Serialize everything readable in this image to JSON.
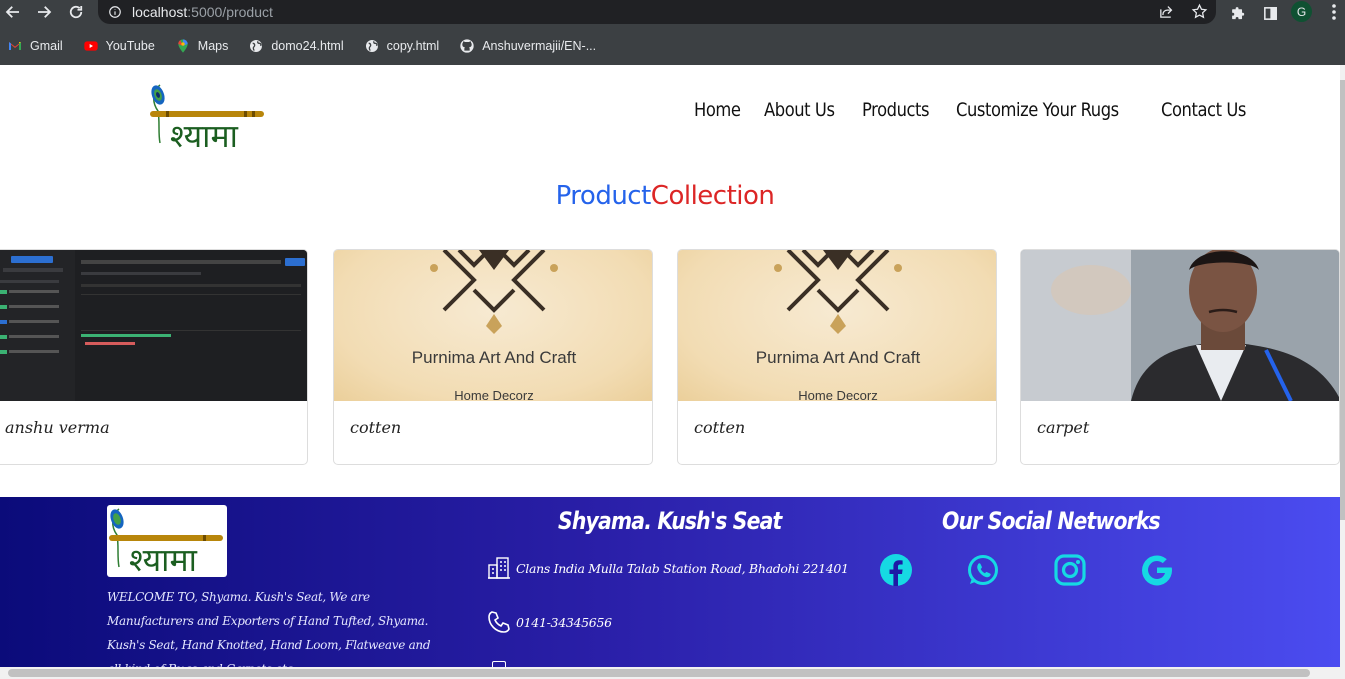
{
  "browser": {
    "url_host": "localhost",
    "url_path": ":5000/product",
    "profile_initial": "G",
    "bookmarks": [
      {
        "label": "Gmail",
        "icon": "gmail-icon"
      },
      {
        "label": "YouTube",
        "icon": "youtube-icon"
      },
      {
        "label": "Maps",
        "icon": "maps-icon"
      },
      {
        "label": "domo24.html",
        "icon": "globe-icon"
      },
      {
        "label": "copy.html",
        "icon": "globe-icon"
      },
      {
        "label": "Anshuvermajii/EN-...",
        "icon": "github-icon"
      }
    ]
  },
  "site": {
    "logo_text": "श्यामा",
    "nav": [
      "Home",
      "About Us",
      "Products",
      "Customize Your Rugs",
      "Contact Us"
    ],
    "heading_part1": "Product",
    "heading_part2": "Collection",
    "heading_colors": {
      "part1": "#2563eb",
      "part2": "#dc2626"
    }
  },
  "products": [
    {
      "name": "anshu verma",
      "image": "screenshot"
    },
    {
      "name": "cotten",
      "image": "purnima",
      "image_title": "Purnima Art And Craft",
      "image_subtitle": "Home Decorz"
    },
    {
      "name": "cotten",
      "image": "purnima",
      "image_title": "Purnima Art And Craft",
      "image_subtitle": "Home Decorz"
    },
    {
      "name": "carpet",
      "image": "photo"
    }
  ],
  "footer": {
    "logo_text": "श्यामा",
    "description": "WELCOME TO, Shyama. Kush's Seat, We are Manufacturers and Exporters of Hand Tufted, Shyama. Kush's Seat, Hand Knotted, Hand Loom, Flatweave and all kind of Rugs and Carpets etc...",
    "contact_title": "Shyama. Kush's Seat",
    "address": "Clans India Mulla Talab Station Road, Bhadohi 221401",
    "phone": "0141-34345656",
    "social_title": "Our Social Networks",
    "social": [
      "facebook-icon",
      "whatsapp-icon",
      "instagram-icon",
      "google-icon"
    ],
    "social_color": "#16d9e3"
  }
}
